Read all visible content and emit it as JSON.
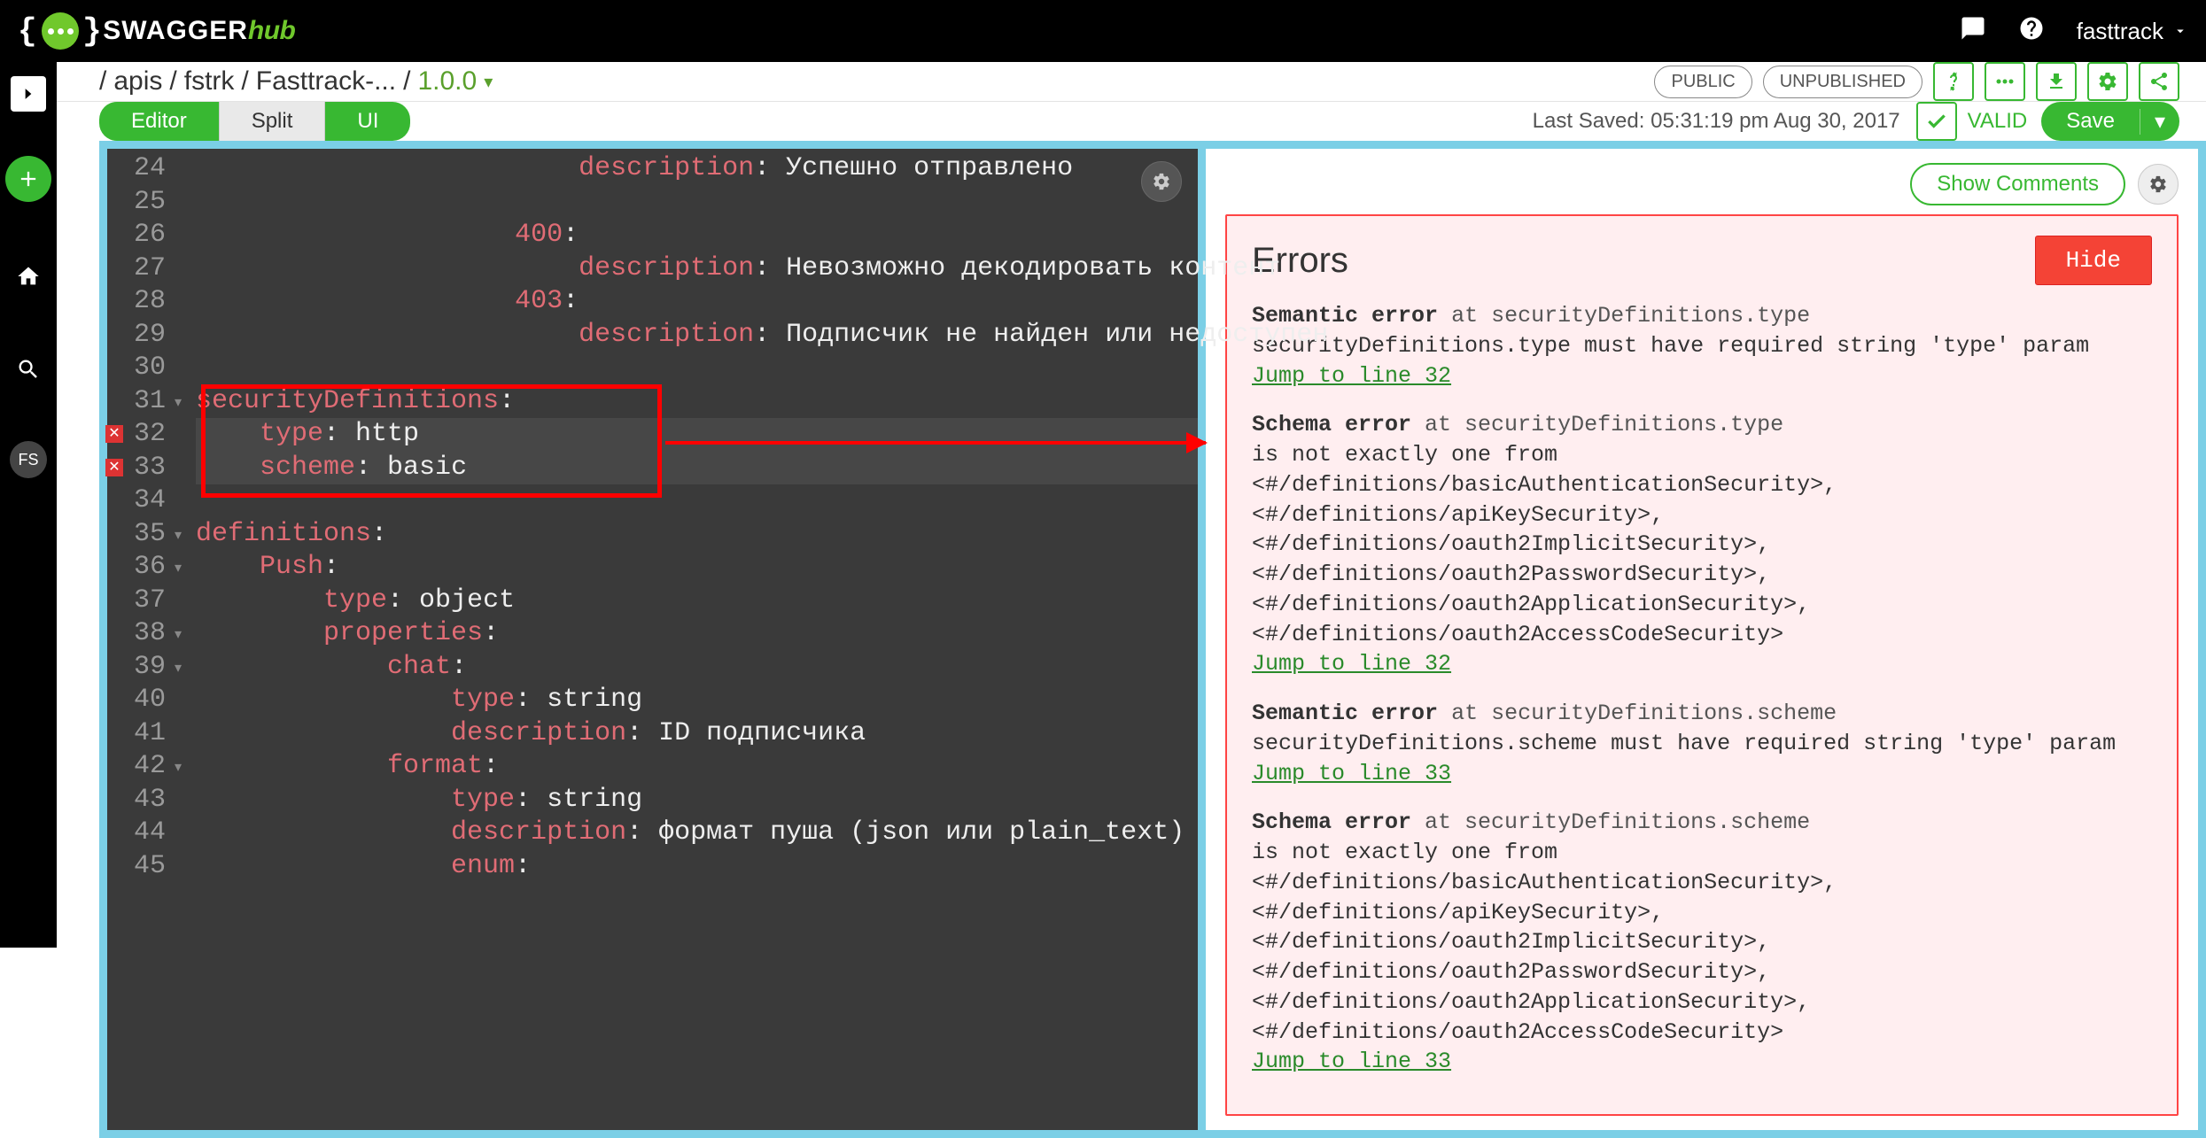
{
  "topbar": {
    "brand_swagger": "SWAGGER",
    "brand_hub": "hub",
    "user": "fasttrack"
  },
  "leftrail": {
    "avatar_initials": "FS"
  },
  "breadcrumb": {
    "seg1": "apis",
    "seg2": "fstrk",
    "seg3": "Fasttrack-...",
    "version": "1.0.0",
    "pill_public": "PUBLIC",
    "pill_unpublished": "UNPUBLISHED"
  },
  "toolbar": {
    "view_editor": "Editor",
    "view_split": "Split",
    "view_ui": "UI",
    "last_saved": "Last Saved: 05:31:19 pm Aug 30, 2017",
    "valid": "VALID",
    "save": "Save"
  },
  "editor": {
    "lines": [
      {
        "n": 24,
        "indent": 12,
        "key": "description",
        "val": " Успешно отправлено"
      },
      {
        "n": 25,
        "indent": 0,
        "raw": ""
      },
      {
        "n": 26,
        "indent": 10,
        "key": "400",
        "val": ""
      },
      {
        "n": 27,
        "indent": 12,
        "key": "description",
        "val": " Невозможно декодировать контент"
      },
      {
        "n": 28,
        "indent": 10,
        "key": "403",
        "val": ""
      },
      {
        "n": 29,
        "indent": 12,
        "key": "description",
        "val": " Подписчик не найден или недоступен"
      },
      {
        "n": 30,
        "indent": 0,
        "raw": ""
      },
      {
        "n": 31,
        "indent": 0,
        "key": "securityDefinitions",
        "val": "",
        "fold": true
      },
      {
        "n": 32,
        "indent": 2,
        "key": "type",
        "val": " http",
        "err": true,
        "hl": true
      },
      {
        "n": 33,
        "indent": 2,
        "key": "scheme",
        "val": " basic",
        "err": true,
        "hl": true
      },
      {
        "n": 34,
        "indent": 0,
        "raw": ""
      },
      {
        "n": 35,
        "indent": 0,
        "key": "definitions",
        "val": "",
        "fold": true
      },
      {
        "n": 36,
        "indent": 2,
        "key": "Push",
        "val": "",
        "fold": true
      },
      {
        "n": 37,
        "indent": 4,
        "key": "type",
        "val": " object"
      },
      {
        "n": 38,
        "indent": 4,
        "key": "properties",
        "val": "",
        "fold": true
      },
      {
        "n": 39,
        "indent": 6,
        "key": "chat",
        "val": "",
        "fold": true
      },
      {
        "n": 40,
        "indent": 8,
        "key": "type",
        "val": " string"
      },
      {
        "n": 41,
        "indent": 8,
        "key": "description",
        "val": " ID подписчика"
      },
      {
        "n": 42,
        "indent": 6,
        "key": "format",
        "val": "",
        "fold": true
      },
      {
        "n": 43,
        "indent": 8,
        "key": "type",
        "val": " string"
      },
      {
        "n": 44,
        "indent": 8,
        "key": "description",
        "val": " формат пуша (json или plain_text)"
      },
      {
        "n": 45,
        "indent": 8,
        "key": "enum",
        "val": "",
        "cut": true
      }
    ]
  },
  "right": {
    "show_comments": "Show Comments",
    "errors_title": "Errors",
    "hide": "Hide",
    "items": [
      {
        "kind": "Semantic error",
        "loc": "securityDefinitions.type",
        "msg": "securityDefinitions.type must have required string 'type' param",
        "jump": "Jump to line 32"
      },
      {
        "kind": "Schema error",
        "loc": "securityDefinitions.type",
        "msg": "is not exactly one from <#/definitions/basicAuthenticationSecurity>,<#/definitions/apiKeySecurity>,<#/definitions/oauth2ImplicitSecurity>,<#/definitions/oauth2PasswordSecurity>,<#/definitions/oauth2ApplicationSecurity>,<#/definitions/oauth2AccessCodeSecurity>",
        "jump": "Jump to line 32"
      },
      {
        "kind": "Semantic error",
        "loc": "securityDefinitions.scheme",
        "msg": "securityDefinitions.scheme must have required string 'type' param",
        "jump": "Jump to line 33"
      },
      {
        "kind": "Schema error",
        "loc": "securityDefinitions.scheme",
        "msg": "is not exactly one from <#/definitions/basicAuthenticationSecurity>,<#/definitions/apiKeySecurity>,<#/definitions/oauth2ImplicitSecurity>,<#/definitions/oauth2PasswordSecurity>,<#/definitions/oauth2ApplicationSecurity>,<#/definitions/oauth2AccessCodeSecurity>",
        "jump": "Jump to line 33"
      }
    ]
  }
}
